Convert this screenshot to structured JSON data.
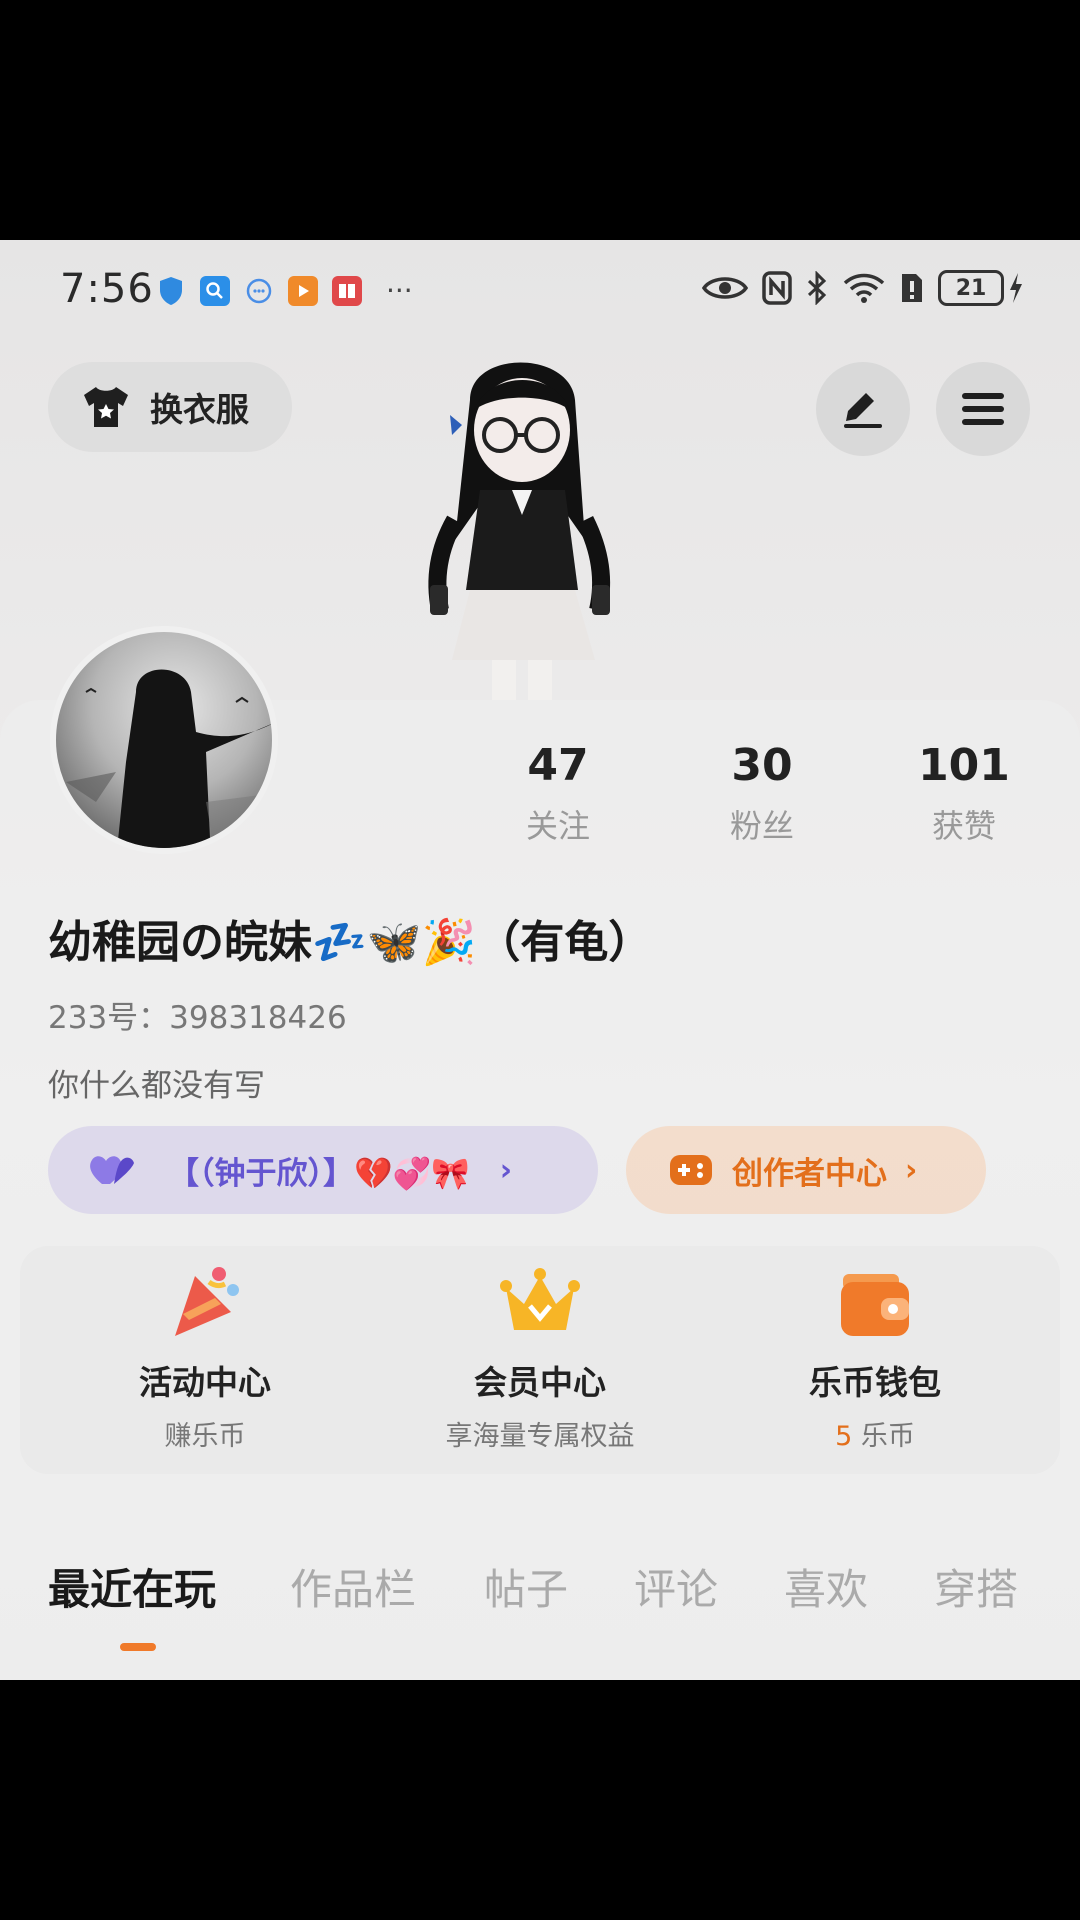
{
  "status_bar": {
    "time": "7:56",
    "battery": "21",
    "more": "···"
  },
  "top_actions": {
    "outfit_label": "换衣服"
  },
  "profile": {
    "stats": [
      {
        "value": "47",
        "label": "关注"
      },
      {
        "value": "30",
        "label": "粉丝"
      },
      {
        "value": "101",
        "label": "获赞"
      }
    ],
    "nickname": "幼稚园の皖妹💤🦋🎉（有龟）",
    "uid": "233号：398318426",
    "bio": "你什么都没有写",
    "relation_text": "【（钟于欣）】💔💞🎀",
    "creator_label": "创作者中心"
  },
  "features": [
    {
      "title": "活动中心",
      "subtitle": "赚乐币",
      "icon": "party-popper-icon"
    },
    {
      "title": "会员中心",
      "subtitle": "享海量专属权益",
      "icon": "crown-icon"
    },
    {
      "title": "乐币钱包",
      "coin_amount": "5",
      "coin_unit": " 乐币",
      "icon": "wallet-icon"
    }
  ],
  "tabs": [
    "最近在玩",
    "作品栏",
    "帖子",
    "评论",
    "喜欢",
    "穿搭"
  ],
  "colors": {
    "accent_orange": "#e36f1b",
    "relation_purple": "#6455d0",
    "tab_indicator": "#f07a2a"
  }
}
